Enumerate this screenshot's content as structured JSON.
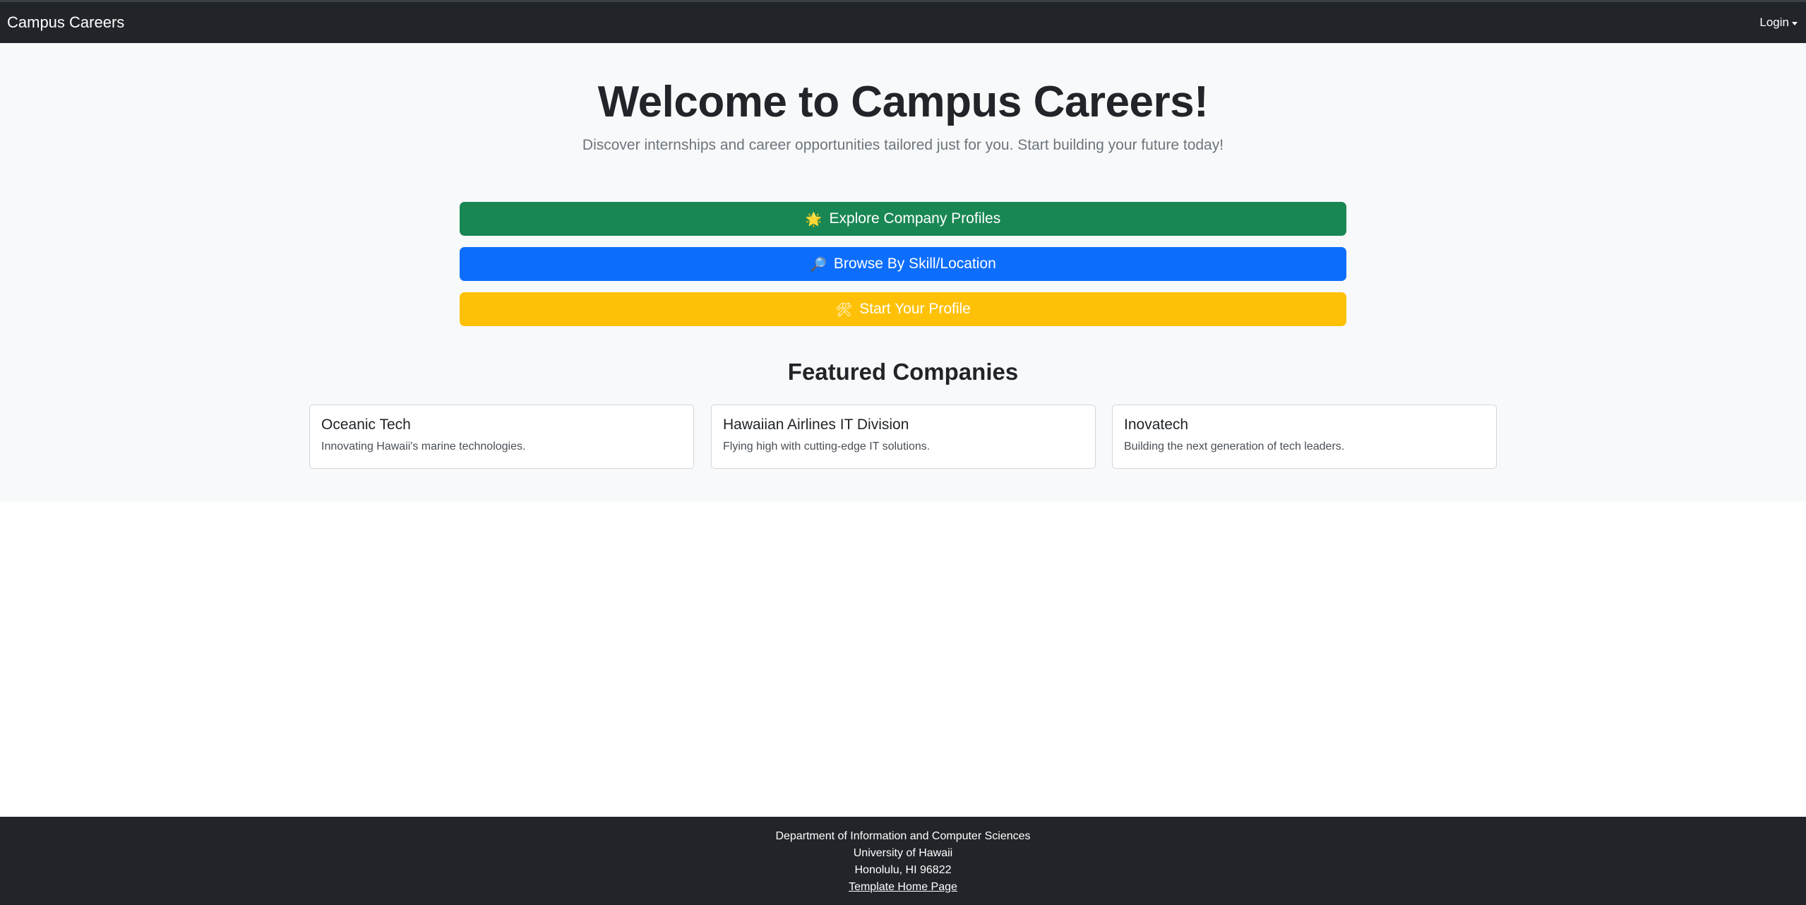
{
  "navbar": {
    "brand": "Campus Careers",
    "login_label": "Login"
  },
  "hero": {
    "title": "Welcome to Campus Careers!",
    "subtitle": "Discover internships and career opportunities tailored just for you. Start building your future today!"
  },
  "actions": [
    {
      "icon": "🌟",
      "label": "Explore Company Profiles",
      "color": "#198754"
    },
    {
      "icon": "🔎",
      "label": "Browse By Skill/Location",
      "color": "#0d6efd"
    },
    {
      "icon": "🛠",
      "label": "Start Your Profile",
      "color": "#ffc107"
    }
  ],
  "featured": {
    "title": "Featured Companies",
    "companies": [
      {
        "name": "Oceanic Tech",
        "description": "Innovating Hawaii's marine technologies."
      },
      {
        "name": "Hawaiian Airlines IT Division",
        "description": "Flying high with cutting-edge IT solutions."
      },
      {
        "name": "Inovatech",
        "description": "Building the next generation of tech leaders."
      }
    ]
  },
  "footer": {
    "line1": "Department of Information and Computer Sciences",
    "line2": "University of Hawaii",
    "line3": "Honolulu, HI 96822",
    "link": "Template Home Page"
  },
  "colors": {
    "navbar_bg": "#212529",
    "hero_bg": "#f8f9fa"
  }
}
